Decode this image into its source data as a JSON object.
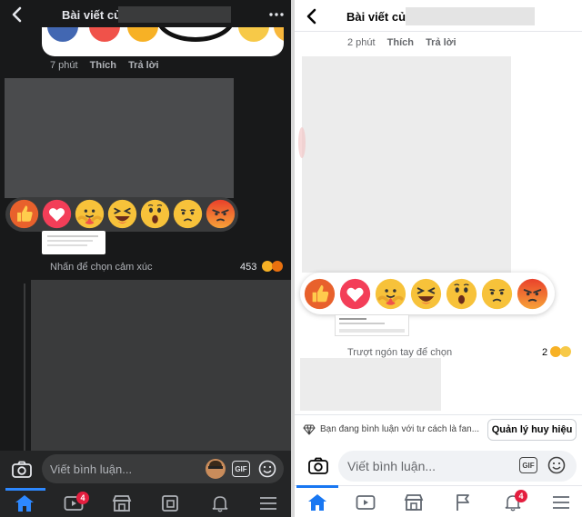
{
  "left": {
    "header": {
      "title": "Bài viết của"
    },
    "comment_meta": {
      "time": "7 phút",
      "like": "Thích",
      "reply": "Trả lời"
    },
    "reaction_hint": "Nhấn để chọn cảm xúc",
    "reaction_count": "453",
    "composer": {
      "placeholder": "Viết bình luận...",
      "gif_label": "GIF"
    },
    "nav": {
      "video_badge": "4"
    }
  },
  "right": {
    "header": {
      "title": "Bài viết của"
    },
    "comment_meta": {
      "time": "2 phút",
      "like": "Thích",
      "reply": "Trả lời"
    },
    "reaction_hint": "Trượt ngón tay để chọn",
    "reaction_count": "2",
    "fan_notice": "Bạn đang bình luận với tư cách là fan...",
    "manage_button": "Quản lý huy hiệu",
    "composer": {
      "placeholder": "Viết bình luận...",
      "gif_label": "GIF"
    },
    "nav": {
      "notifications_badge": "4"
    }
  },
  "reactions": [
    "like",
    "love",
    "care",
    "haha",
    "wow",
    "sad",
    "angry"
  ],
  "colors": {
    "accent": "#1877f2",
    "badge": "#e41e3f",
    "dark_bg": "#18191a",
    "dark_surface": "#3a3b3c"
  }
}
